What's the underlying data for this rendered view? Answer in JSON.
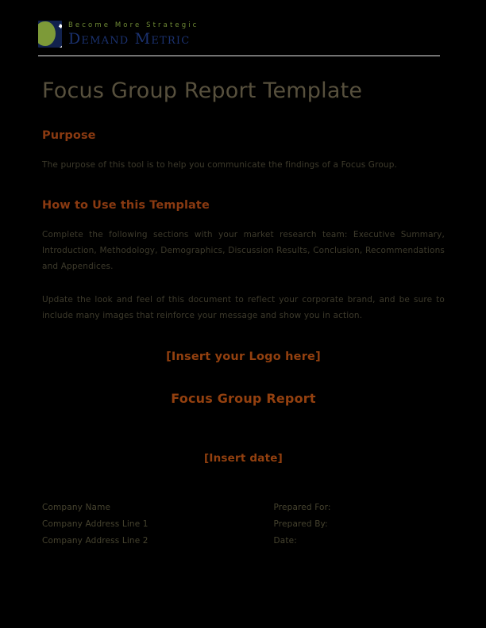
{
  "document": {
    "title": "Focus Group Report Template",
    "page_background": "#000000"
  },
  "header": {
    "logo": {
      "icon": "demand-metric-logo-mark",
      "mark_background": "#12224e",
      "leaf_color": "#7d9a38",
      "swoosh_color": "#ffffff"
    },
    "tagline": "Become More Strategic",
    "tagline_color": "#6f8a35",
    "brand": "Demand Metric",
    "brand_color": "#1b3270",
    "rule_color": "#e8e8e8"
  },
  "main": {
    "title": "Focus Group Report Template",
    "title_color": "#57503d",
    "heading_color": "#8a3a11",
    "body_color": "#3e3b2c",
    "accent_color": "#93400f",
    "sections": [
      {
        "heading": "Purpose",
        "paragraphs": [
          "The purpose of this tool is to help you communicate the findings of a Focus Group."
        ]
      },
      {
        "heading": "How to Use this Template",
        "paragraphs": [
          "Complete the following sections with your market research team:  Executive Summary, Introduction, Methodology, Demographics, Discussion Results, Conclusion, Recommendations and Appendices.",
          "Update the look and feel of this document to reflect your corporate brand, and be sure to include many images that reinforce your message and show you in action."
        ]
      }
    ],
    "cover": {
      "logo_placeholder": "[Insert your Logo here]",
      "report_title": "Focus Group Report",
      "date_placeholder": "[Insert date]"
    }
  },
  "details": {
    "left_column": [
      "Company Name",
      "Company Address Line 1",
      "Company Address Line 2"
    ],
    "right_column": [
      "Prepared For:",
      "Prepared By:",
      "Date:"
    ]
  }
}
